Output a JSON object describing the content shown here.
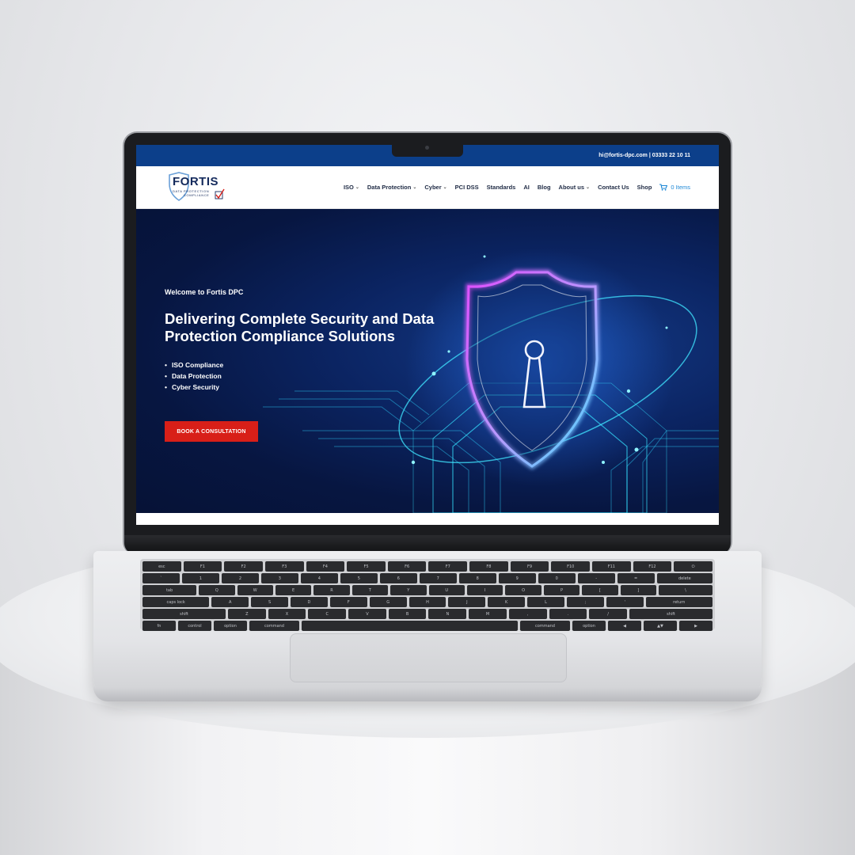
{
  "site": {
    "topbar": {
      "contact": "hi@fortis-dpc.com | 03333 22 10 11"
    },
    "logo": {
      "name": "FORTIS",
      "subline1": "DATA PROTECTION",
      "subline2": "COMPLIANCE"
    },
    "nav": {
      "items": [
        {
          "label": "ISO",
          "has_dropdown": true
        },
        {
          "label": "Data Protection",
          "has_dropdown": true
        },
        {
          "label": "Cyber",
          "has_dropdown": true
        },
        {
          "label": "PCI DSS",
          "has_dropdown": false
        },
        {
          "label": "Standards",
          "has_dropdown": false
        },
        {
          "label": "AI",
          "has_dropdown": false
        },
        {
          "label": "Blog",
          "has_dropdown": false
        },
        {
          "label": "About us",
          "has_dropdown": true
        },
        {
          "label": "Contact Us",
          "has_dropdown": false
        },
        {
          "label": "Shop",
          "has_dropdown": false
        }
      ],
      "cart_label": "0 Items",
      "chevron": "⌄"
    },
    "hero": {
      "welcome": "Welcome to Fortis DPC",
      "headline": "Delivering Complete Security and Data Protection Compliance Solutions",
      "bullets": [
        "ISO Compliance",
        "Data Protection",
        "Cyber Security"
      ],
      "cta_label": "BOOK A CONSULTATION"
    },
    "colors": {
      "topbar": "#0c3f8a",
      "cta": "#d81f18",
      "brand_navy": "#142a5c",
      "cart_blue": "#1e88d6",
      "glow_cyan": "#3fe0ff",
      "glow_magenta": "#e04cff"
    },
    "icons": [
      "shield-check-logo-icon",
      "cart-icon",
      "shield-keyhole-icon"
    ]
  },
  "keyboard": {
    "row1": [
      "esc",
      "F1",
      "F2",
      "F3",
      "F4",
      "F5",
      "F6",
      "F7",
      "F8",
      "F9",
      "F10",
      "F11",
      "F12",
      "⏻"
    ],
    "row2": [
      "`",
      "1",
      "2",
      "3",
      "4",
      "5",
      "6",
      "7",
      "8",
      "9",
      "0",
      "-",
      "=",
      "delete"
    ],
    "row3": [
      "tab",
      "Q",
      "W",
      "E",
      "R",
      "T",
      "Y",
      "U",
      "I",
      "O",
      "P",
      "[",
      "]",
      "\\"
    ],
    "row4": [
      "caps lock",
      "A",
      "S",
      "D",
      "F",
      "G",
      "H",
      "J",
      "K",
      "L",
      ";",
      "'",
      "return"
    ],
    "row5": [
      "shift",
      "Z",
      "X",
      "C",
      "V",
      "B",
      "N",
      "M",
      ",",
      ".",
      "/",
      "shift"
    ],
    "row6": [
      "fn",
      "control",
      "option",
      "command",
      "",
      "command",
      "option",
      "◀",
      "▲▼",
      "▶"
    ]
  }
}
